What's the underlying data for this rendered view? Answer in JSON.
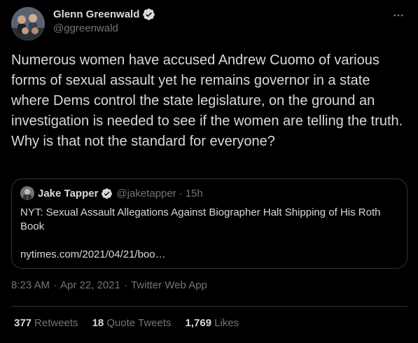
{
  "author": {
    "name": "Glenn Greenwald",
    "handle": "@ggreenwald"
  },
  "tweet": {
    "text": "Numerous women have accused Andrew Cuomo of various forms of sexual assault yet he remains governor in a state where Dems control the state legislature, on the ground an investigation is needed to see if the women are telling the truth. Why is that not the standard for everyone?"
  },
  "quote": {
    "name": "Jake Tapper",
    "handle": "@jaketapper",
    "separator": "·",
    "time": "15h",
    "text": "NYT: Sexual Assault Allegations Against Biographer Halt Shipping of His Roth Book",
    "link": "nytimes.com/2021/04/21/boo…"
  },
  "meta": {
    "time": "8:23 AM",
    "sep1": "·",
    "date": "Apr 22, 2021",
    "sep2": "·",
    "source": "Twitter Web App"
  },
  "stats": [
    {
      "count": "377",
      "label": "Retweets"
    },
    {
      "count": "18",
      "label": "Quote Tweets"
    },
    {
      "count": "1,769",
      "label": "Likes"
    }
  ],
  "colors": {
    "background": "#000000",
    "text": "#d9d9d9",
    "secondary": "#6e767d",
    "border": "#2f3336",
    "verified": "#d9d9d9"
  },
  "icons": {
    "verified": "verified-badge-icon",
    "more": "more-horizontal-icon"
  }
}
